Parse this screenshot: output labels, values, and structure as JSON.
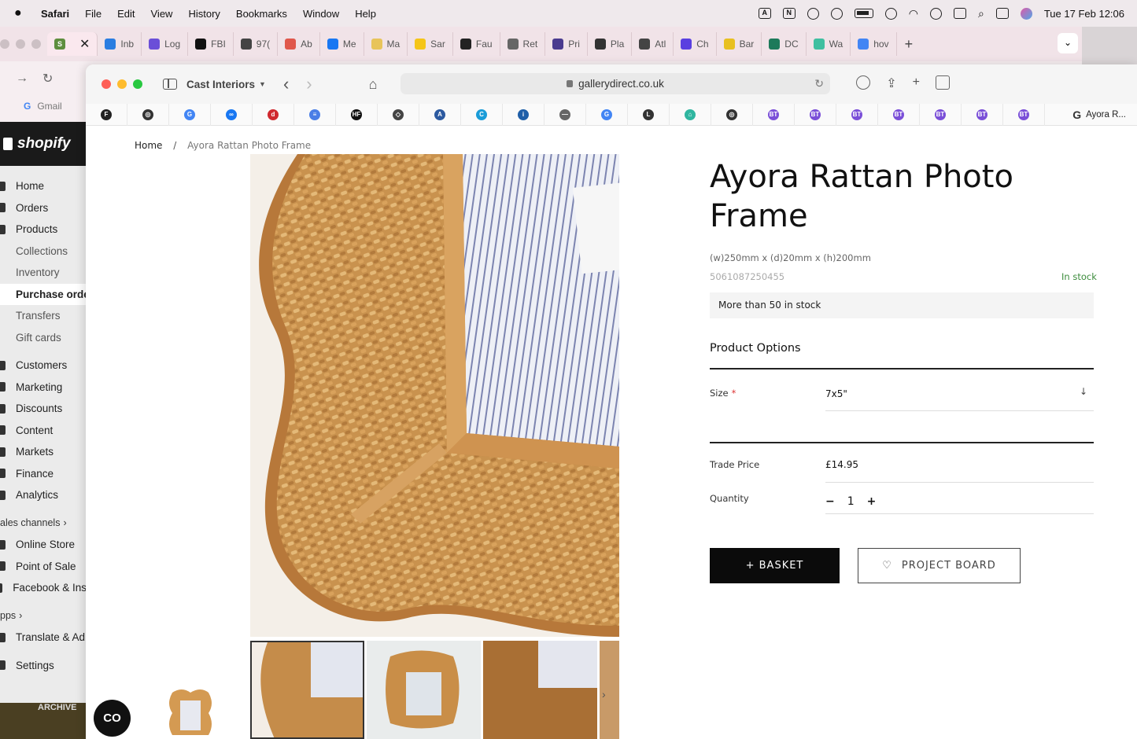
{
  "menubar": {
    "app": "Safari",
    "items": [
      "File",
      "Edit",
      "View",
      "History",
      "Bookmarks",
      "Window",
      "Help"
    ],
    "datetime": "Tue 17 Feb  12:06"
  },
  "back_tabs": [
    {
      "label": "Inb",
      "color": "#2a7de1"
    },
    {
      "label": "Log",
      "color": "#6b4fd8"
    },
    {
      "label": "FBI",
      "color": "#111111"
    },
    {
      "label": "97(",
      "color": "#444444"
    },
    {
      "label": "Ab",
      "color": "#e0574b"
    },
    {
      "label": "Me",
      "color": "#1877f2"
    },
    {
      "label": "Ma",
      "color": "#e8c45a"
    },
    {
      "label": "Sar",
      "color": "#f5c518"
    },
    {
      "label": "Fau",
      "color": "#222222"
    },
    {
      "label": "Ret",
      "color": "#666666"
    },
    {
      "label": "Pri",
      "color": "#4a3b8f"
    },
    {
      "label": "Pla",
      "color": "#333333"
    },
    {
      "label": "Atl",
      "color": "#444444"
    },
    {
      "label": "Ch",
      "color": "#5a3fe0"
    },
    {
      "label": "Bar",
      "color": "#e8c020"
    },
    {
      "label": "DC",
      "color": "#1d7a5a"
    },
    {
      "label": "Wa",
      "color": "#3fbfa0"
    },
    {
      "label": "hov",
      "color": "#4285f4"
    }
  ],
  "back_toolbar": {
    "bookmark": "Gmail"
  },
  "shopify": {
    "brand": "shopify",
    "nav": [
      {
        "label": "Home",
        "kind": "main"
      },
      {
        "label": "Orders",
        "kind": "main"
      },
      {
        "label": "Products",
        "kind": "main"
      },
      {
        "label": "Collections",
        "kind": "sub"
      },
      {
        "label": "Inventory",
        "kind": "sub"
      },
      {
        "label": "Purchase orde",
        "kind": "subsel"
      },
      {
        "label": "Transfers",
        "kind": "sub"
      },
      {
        "label": "Gift cards",
        "kind": "sub"
      },
      {
        "label": "Customers",
        "kind": "main"
      },
      {
        "label": "Marketing",
        "kind": "main"
      },
      {
        "label": "Discounts",
        "kind": "main"
      },
      {
        "label": "Content",
        "kind": "main"
      },
      {
        "label": "Markets",
        "kind": "main"
      },
      {
        "label": "Finance",
        "kind": "main"
      },
      {
        "label": "Analytics",
        "kind": "main"
      }
    ],
    "sales_channels_label": "ales channels",
    "channels": [
      "Online Store",
      "Point of Sale",
      "Facebook & Ins"
    ],
    "apps_label": "pps",
    "apps": [
      "Translate & Ad"
    ],
    "settings": "Settings",
    "archive": "ARCHIVE"
  },
  "front": {
    "group": "Cast Interiors",
    "url": "gallerydirect.co.uk",
    "favorites_last": "Ayora R...",
    "favorites": [
      {
        "icon": "figma-icon",
        "color": "#222222",
        "t": "F"
      },
      {
        "icon": "openai-icon",
        "color": "#333333",
        "t": "◎"
      },
      {
        "icon": "google-icon",
        "color": "#4285f4",
        "t": "G"
      },
      {
        "icon": "meta-icon",
        "color": "#1877f2",
        "t": "∞"
      },
      {
        "icon": "d-icon",
        "color": "#d0282e",
        "t": "d"
      },
      {
        "icon": "docs-icon",
        "color": "#4a7ee6",
        "t": "≡"
      },
      {
        "icon": "hf-icon",
        "color": "#111111",
        "t": "HF"
      },
      {
        "icon": "stack-icon",
        "color": "#444444",
        "t": "◇"
      },
      {
        "icon": "a-icon",
        "color": "#2c5aa0",
        "t": "A"
      },
      {
        "icon": "c-icon",
        "color": "#1a9cd8",
        "t": "C"
      },
      {
        "icon": "i-icon",
        "color": "#1f5fa8",
        "t": "i"
      },
      {
        "icon": "site-icon",
        "color": "#666666",
        "t": "—"
      },
      {
        "icon": "google-icon",
        "color": "#4285f4",
        "t": "G"
      },
      {
        "icon": "l-icon",
        "color": "#333333",
        "t": "L"
      },
      {
        "icon": "home-app-icon",
        "color": "#2fb6a0",
        "t": "⌂"
      },
      {
        "icon": "openai-icon",
        "color": "#333333",
        "t": "◎"
      },
      {
        "icon": "bt-icon",
        "color": "#7a4fd8",
        "t": "BT"
      },
      {
        "icon": "bt-icon",
        "color": "#7a4fd8",
        "t": "BT"
      },
      {
        "icon": "bt-icon",
        "color": "#7a4fd8",
        "t": "BT"
      },
      {
        "icon": "bt-icon",
        "color": "#7a4fd8",
        "t": "BT"
      },
      {
        "icon": "bt-icon",
        "color": "#7a4fd8",
        "t": "BT"
      },
      {
        "icon": "bt-icon",
        "color": "#7a4fd8",
        "t": "BT"
      },
      {
        "icon": "bt-icon",
        "color": "#7a4fd8",
        "t": "BT"
      }
    ]
  },
  "product": {
    "breadcrumb_home": "Home",
    "breadcrumb_sep": "/",
    "breadcrumb_current": "Ayora Rattan Photo Frame",
    "title": "Ayora Rattan Photo Frame",
    "dimensions": "(w)250mm x (d)20mm x (h)200mm",
    "sku": "5061087250455",
    "stock_status": "In stock",
    "stock_detail": "More than 50 in stock",
    "options_title": "Product Options",
    "size_label": "Size",
    "size_required": "*",
    "size_value": "7x5\"",
    "trade_price_label": "Trade Price",
    "trade_price": "£14.95",
    "quantity_label": "Quantity",
    "quantity": "1",
    "basket_label": "+ BASKET",
    "project_board_label": "PROJECT BOARD",
    "chat_label": "CO"
  }
}
